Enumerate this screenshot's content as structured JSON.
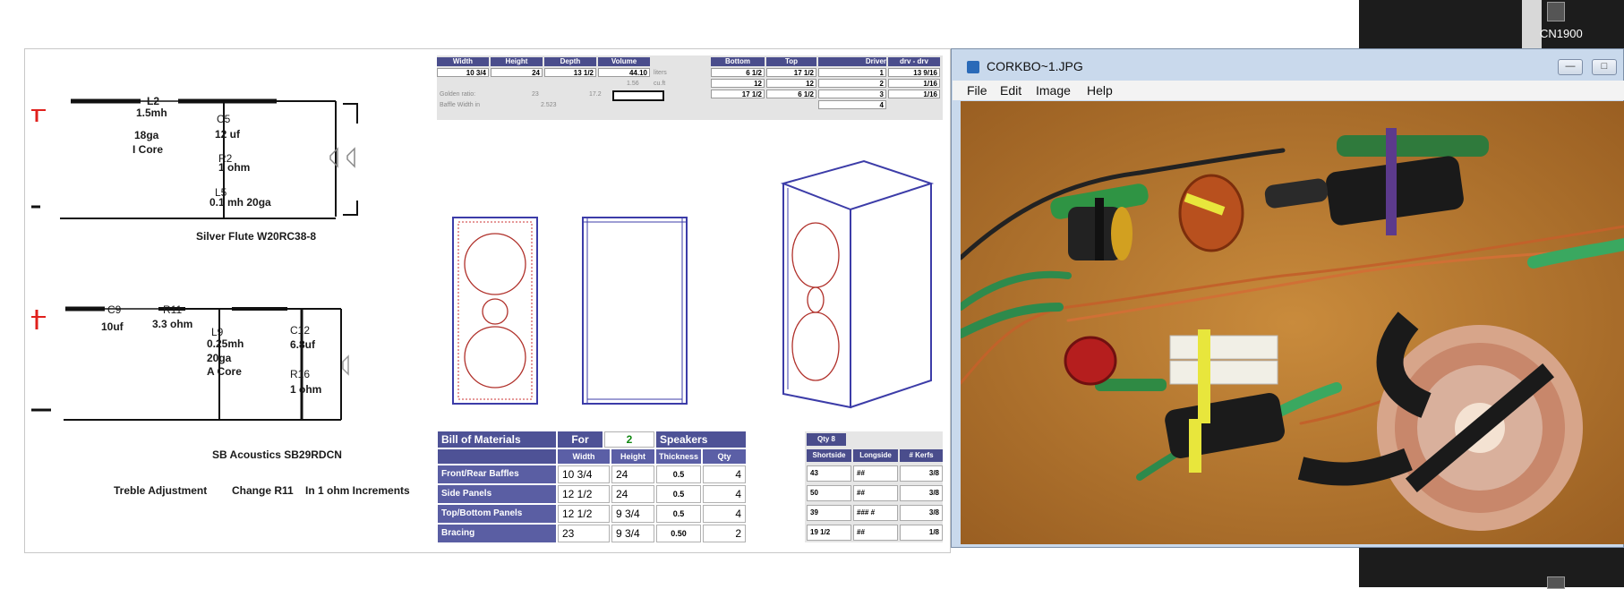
{
  "schematic": {
    "tweeter_labels": {
      "l2": "L2",
      "l2_val": "1.5mh",
      "l2_gauge": "18ga",
      "l2_core": "I Core",
      "c5": "C5",
      "c5_val": "12 uf",
      "r2": "R2",
      "r2_val": "1    ohm",
      "l5": "L5",
      "l5_val": "0.1   mh 20ga",
      "driver": "Silver Flute W20RC38-8"
    },
    "woofer_labels": {
      "c9": "C9",
      "c9_val": "10uf",
      "r11": "R11",
      "r11_val": "3.3 ohm",
      "l9": "L9",
      "l9_val": "0.25mh",
      "l9_gauge": "20ga",
      "l9_core": "A Core",
      "c12": "C12",
      "c12_val": "6.8uf",
      "r16": "R16",
      "r16_val": "1 ohm",
      "driver": "SB Acoustics SB29RDCN"
    },
    "note": {
      "a": "Treble Adjustment",
      "b": "Change R11",
      "c": "In 1 ohm Increments"
    }
  },
  "dimensions": {
    "headers": [
      "Width",
      "Height",
      "Depth",
      "Volume"
    ],
    "values": [
      "10 3/4",
      "24",
      "13 1/2",
      "44.10"
    ],
    "vol_unit": "liters",
    "cuft_unit": "cu.ft",
    "cuft_val": "1.56",
    "golden_label": "Golden ratio:",
    "golden_vals": [
      "23",
      "17.2"
    ],
    "baffle_label": "Baffle Width in",
    "baffle_val": "2.523",
    "bt_headers": [
      "Bottom",
      "Top"
    ],
    "bt_rows": [
      [
        "6 1/2",
        "17 1/2"
      ],
      [
        "12",
        "12"
      ],
      [
        "17 1/2",
        "6 1/2"
      ]
    ],
    "driver_headers": [
      "Driver",
      "drv - drv"
    ],
    "driver_rows": [
      [
        "1",
        "13  9/16"
      ],
      [
        "2",
        "1/16"
      ],
      [
        "3",
        "1/16"
      ],
      [
        "4",
        ""
      ]
    ]
  },
  "bom": {
    "title": "Bill of Materials",
    "for_label": "For",
    "for_value": "2",
    "speakers_label": "Speakers",
    "headers": [
      "Width",
      "Height",
      "Thickness",
      "Qty"
    ],
    "rows": [
      {
        "name": "Front/Rear Baffles",
        "width": "10 3/4",
        "height": "24",
        "thick": "0.5",
        "qty": "4"
      },
      {
        "name": "Side Panels",
        "width": "12 1/2",
        "height": "24",
        "thick": "0.5",
        "qty": "4"
      },
      {
        "name": "Top/Bottom Panels",
        "width": "12 1/2",
        "height": "9 3/4",
        "thick": "0.5",
        "qty": "4"
      },
      {
        "name": "Bracing",
        "width": "23",
        "height": "9 3/4",
        "thick": "0.50",
        "qty": "2"
      }
    ]
  },
  "qty_table": {
    "title": "Qty 8",
    "headers": [
      "Shortside",
      "Longside",
      "# Kerfs"
    ],
    "rows": [
      [
        "43",
        "##",
        "3/8"
      ],
      [
        "50",
        "##",
        "3/8"
      ],
      [
        "39",
        "### #",
        "3/8"
      ],
      [
        "19  1/2",
        "##",
        "1/8"
      ]
    ]
  },
  "viewer": {
    "title": "CORKBO~1.JPG",
    "menu": [
      "File",
      "Edit",
      "Image",
      "Help"
    ]
  },
  "desktop": {
    "icon_label": "CN1900"
  },
  "colors": {
    "table_header": "#4e5296",
    "driver_line": "#3c3ca8",
    "circle_red": "#b0302a",
    "plus_red": "#e0201c"
  }
}
